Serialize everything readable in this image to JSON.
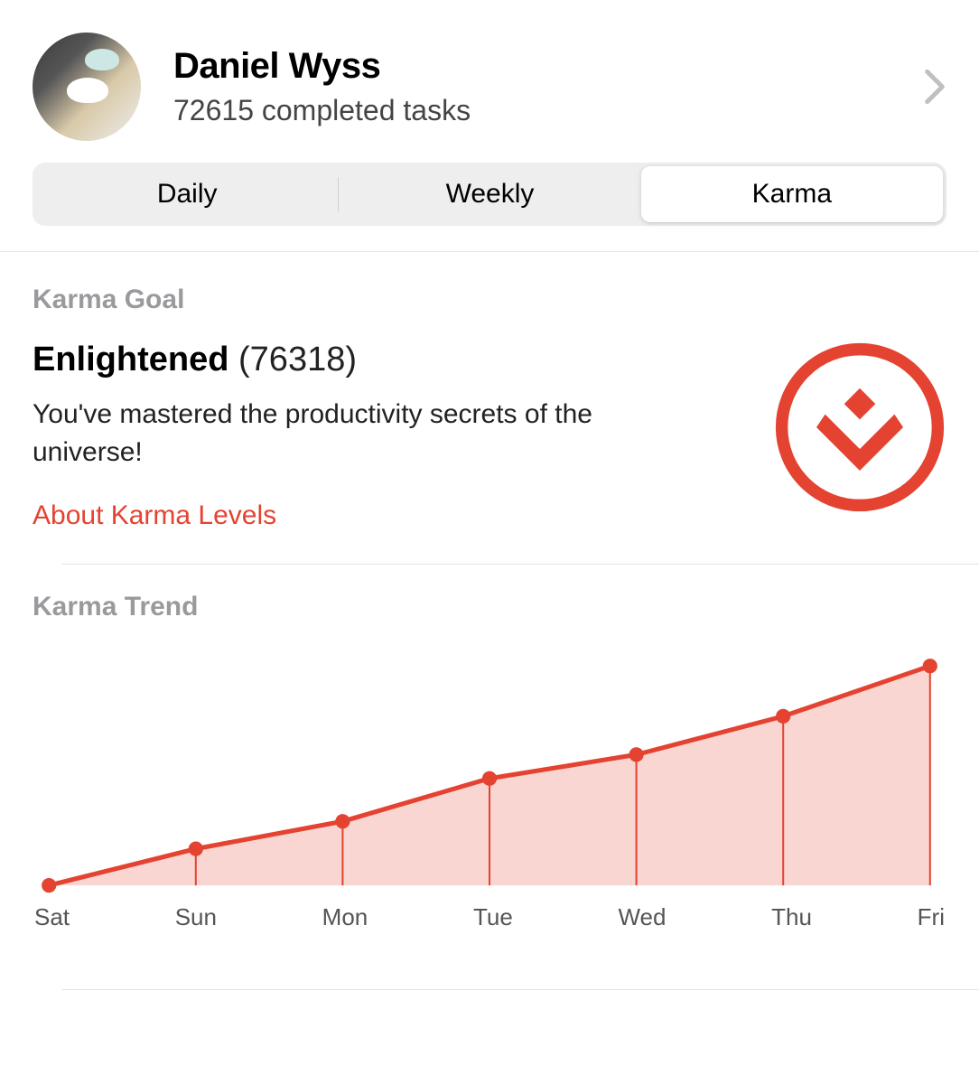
{
  "profile": {
    "name": "Daniel Wyss",
    "subtitle": "72615 completed tasks"
  },
  "tabs": {
    "items": [
      "Daily",
      "Weekly",
      "Karma"
    ],
    "active_index": 2
  },
  "karma_goal": {
    "section_title": "Karma Goal",
    "level_name": "Enlightened",
    "points_display": "(76318)",
    "description": "You've mastered the productivity secrets of the universe!",
    "about_link": "About Karma Levels"
  },
  "karma_trend": {
    "section_title": "Karma Trend"
  },
  "chart_data": {
    "type": "area-line",
    "categories": [
      "Sat",
      "Sun",
      "Mon",
      "Tue",
      "Wed",
      "Thu",
      "Fri"
    ],
    "values": [
      0,
      40,
      70,
      117,
      143,
      185,
      240
    ],
    "ylim": [
      0,
      250
    ],
    "color_line": "#e44332",
    "color_fill": "#f9d6d1",
    "xlabel": "",
    "ylabel": "",
    "title": ""
  }
}
